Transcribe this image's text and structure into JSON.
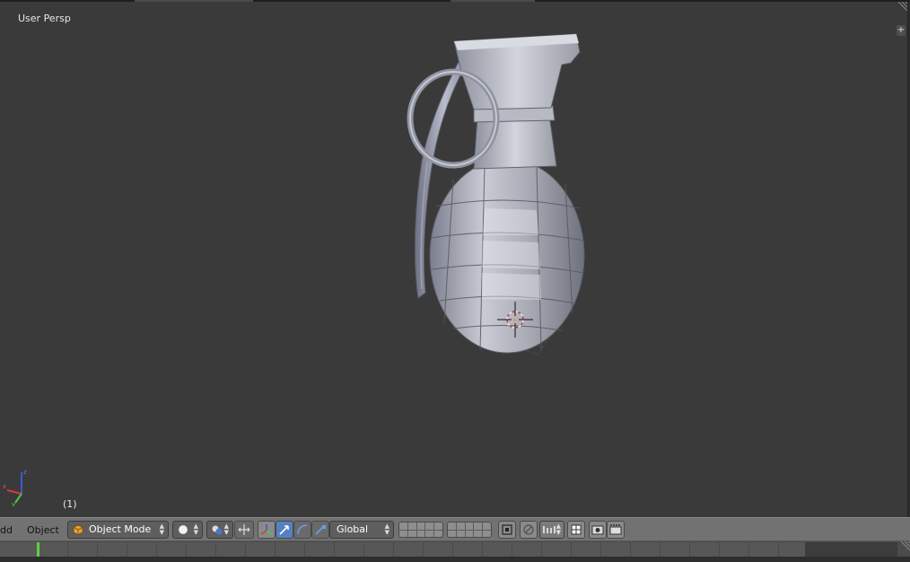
{
  "viewport": {
    "view_label": "User Persp",
    "frame_label": "(1)",
    "axis_z": "z",
    "axis_y": "y",
    "axis_x": "x"
  },
  "header": {
    "menu_add_partial": "dd",
    "menu_object": "Object",
    "mode_select": {
      "value": "Object Mode",
      "icon": "cube-icon"
    },
    "viewport_shading": {
      "icon": "solid-sphere-icon"
    },
    "pivot_point": {
      "icon": "pivot-icon"
    },
    "transform_orientation": {
      "value": "Global"
    },
    "icons": [
      "manipulator-icon",
      "translate-icon",
      "rotate-icon",
      "scale-icon",
      "layers-grid-icon",
      "lock-icon",
      "proportional-edit-icon",
      "snap-icon",
      "snap-element-icon",
      "render-icon",
      "render-anim-icon"
    ]
  },
  "colors": {
    "viewport_bg": "#3a3a3a",
    "header_bg": "#727272",
    "active_button": "#5680c2",
    "timeline_cursor": "#5bd042"
  }
}
